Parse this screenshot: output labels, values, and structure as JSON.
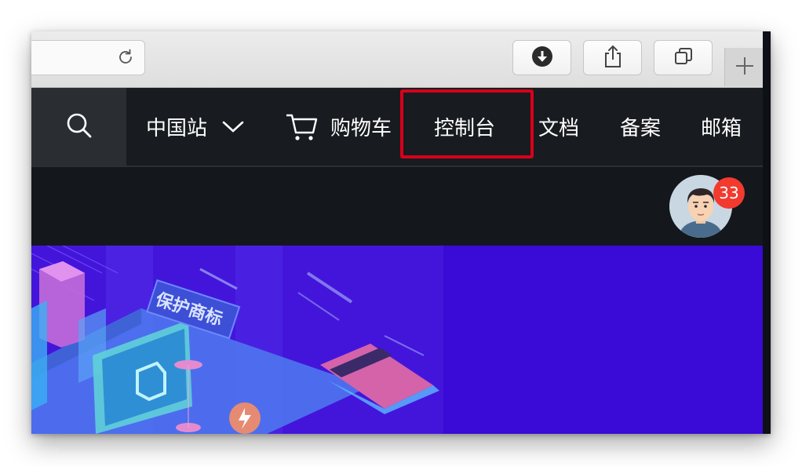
{
  "browser": {
    "toolbar": {
      "reload_icon": "reload-icon",
      "download_icon": "download-icon",
      "share_icon": "share-icon",
      "tabs_icon": "tabs-overview-icon",
      "new_tab_icon": "plus-icon"
    }
  },
  "nav": {
    "search_icon": "search-icon",
    "region_label": "中国站",
    "region_chevron_icon": "chevron-down-icon",
    "cart_icon": "cart-icon",
    "cart_label": "购物车",
    "console_label": "控制台",
    "docs_label": "文档",
    "icp_label": "备案",
    "mail_label": "邮箱"
  },
  "user": {
    "notification_count": "33"
  },
  "hero": {
    "banner_text": "保护商标"
  },
  "colors": {
    "nav_bg": "#181b1f",
    "search_bg": "#2a2e33",
    "highlight": "#d9001b",
    "badge": "#f23a2f",
    "hero_bg": "#3a0ad6"
  }
}
